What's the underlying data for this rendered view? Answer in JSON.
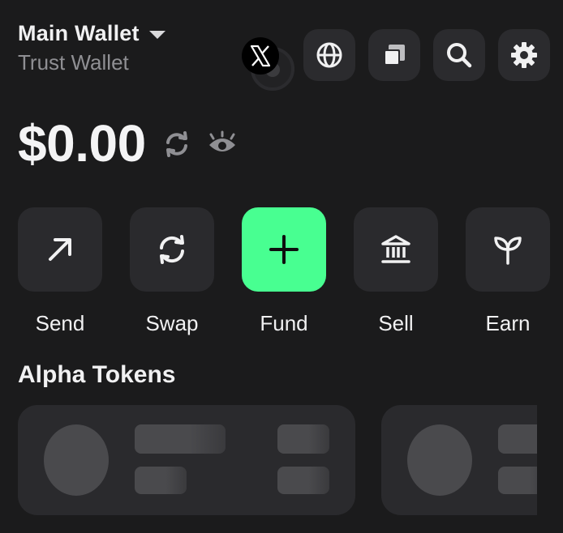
{
  "header": {
    "wallet_name": "Main Wallet",
    "wallet_subtitle": "Trust Wallet",
    "icons": [
      "x-logo-icon",
      "globe-icon",
      "copy-icon",
      "search-icon",
      "gear-icon"
    ]
  },
  "balance": {
    "amount": "$0.00",
    "icons": [
      "refresh-icon",
      "eye-icon"
    ]
  },
  "actions": [
    {
      "label": "Send",
      "icon": "arrow-up-right-icon"
    },
    {
      "label": "Swap",
      "icon": "swap-icon"
    },
    {
      "label": "Fund",
      "icon": "plus-icon"
    },
    {
      "label": "Sell",
      "icon": "bank-icon"
    },
    {
      "label": "Earn",
      "icon": "sprout-icon"
    }
  ],
  "sections": {
    "alpha_tokens": "Alpha Tokens"
  },
  "colors": {
    "background": "#1b1b1c",
    "surface": "#2a2a2d",
    "accent": "#48ff91",
    "muted_text": "#8f8f93"
  }
}
